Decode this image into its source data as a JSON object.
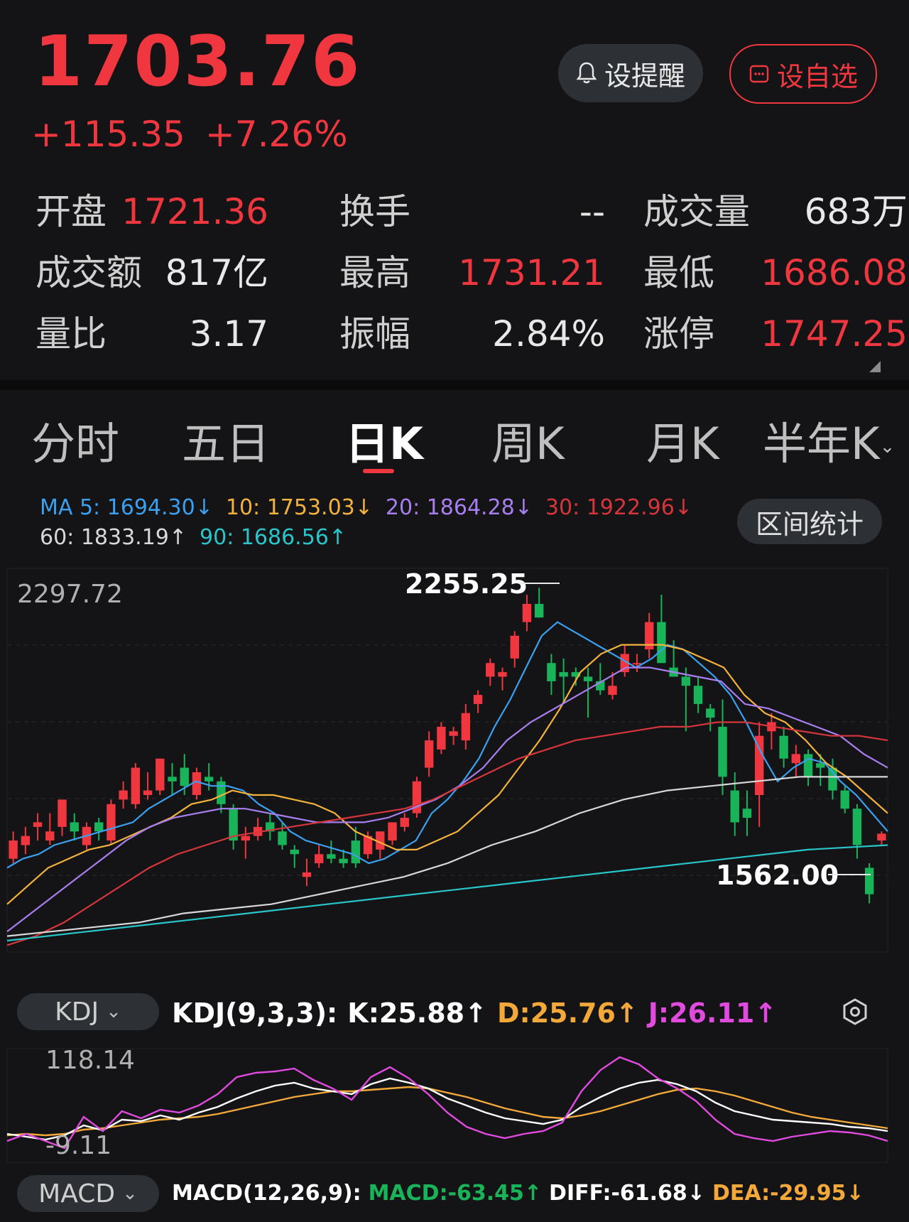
{
  "quote": {
    "price": "1703.76",
    "change": "+115.35",
    "change_pct": "+7.26%"
  },
  "actions": {
    "alert_label": "设提醒",
    "favorite_label": "设自选"
  },
  "stats": [
    [
      {
        "label": "开盘",
        "value": "1721.36",
        "color": "red"
      },
      {
        "label": "换手",
        "value": "--",
        "color": "white"
      },
      {
        "label": "成交量",
        "value": "683万",
        "color": "white"
      }
    ],
    [
      {
        "label": "成交额",
        "value": "817亿",
        "color": "white"
      },
      {
        "label": "最高",
        "value": "1731.21",
        "color": "red"
      },
      {
        "label": "最低",
        "value": "1686.08",
        "color": "red"
      }
    ],
    [
      {
        "label": "量比",
        "value": "3.17",
        "color": "white"
      },
      {
        "label": "振幅",
        "value": "2.84%",
        "color": "white"
      },
      {
        "label": "涨停",
        "value": "1747.25",
        "color": "red"
      }
    ]
  ],
  "tabs": [
    "分时",
    "五日",
    "日K",
    "周K",
    "月K",
    "半年K"
  ],
  "active_tab": "日K",
  "ma_legend": {
    "ma5": "MA 5: 1694.30↓",
    "ma10": "10: 1753.03↓",
    "ma20": "20: 1864.28↓",
    "ma30": "30: 1922.96↓",
    "ma60": "60: 1833.19↑",
    "ma90": "90: 1686.56↑"
  },
  "range_button": "区间统计",
  "chart_axis": {
    "top_label": "2297.72",
    "high_annot": "2255.25",
    "low_annot": "1562.00"
  },
  "kdj": {
    "selector": "KDJ",
    "params": "KDJ(9,3,3):",
    "k": "K:25.88↑",
    "d": "D:25.76↑",
    "j": "J:26.11↑",
    "y_top": "118.14",
    "y_bottom": "-9.11"
  },
  "macd": {
    "selector": "MACD",
    "params": "MACD(12,26,9):",
    "macd": "MACD:-63.45↑",
    "diff": "DIFF:-61.68↓",
    "dea": "DEA:-29.95↓"
  },
  "colors": {
    "up": "#f0373f",
    "down": "#19b45a",
    "ma5": "#3aa0ef",
    "ma10": "#f3b23c",
    "ma20": "#a77ff0",
    "ma30": "#d7353c",
    "ma60": "#d8d8d8",
    "ma90": "#28c6c9",
    "kdj_k": "#ffffff",
    "kdj_d": "#f3a93a",
    "kdj_j": "#e04adf",
    "macd_val": "#19b45a"
  },
  "chart_data": {
    "type": "candlestick",
    "price_range": [
      1455,
      2298
    ],
    "candles": [
      {
        "o": 1660,
        "h": 1720,
        "l": 1650,
        "c": 1700
      },
      {
        "o": 1690,
        "h": 1730,
        "l": 1670,
        "c": 1710
      },
      {
        "o": 1730,
        "h": 1760,
        "l": 1700,
        "c": 1740
      },
      {
        "o": 1700,
        "h": 1760,
        "l": 1690,
        "c": 1720
      },
      {
        "o": 1730,
        "h": 1780,
        "l": 1710,
        "c": 1790
      },
      {
        "o": 1740,
        "h": 1760,
        "l": 1700,
        "c": 1720
      },
      {
        "o": 1690,
        "h": 1740,
        "l": 1680,
        "c": 1730
      },
      {
        "o": 1740,
        "h": 1750,
        "l": 1700,
        "c": 1720
      },
      {
        "o": 1700,
        "h": 1790,
        "l": 1690,
        "c": 1780
      },
      {
        "o": 1790,
        "h": 1830,
        "l": 1770,
        "c": 1810
      },
      {
        "o": 1780,
        "h": 1870,
        "l": 1770,
        "c": 1860
      },
      {
        "o": 1800,
        "h": 1850,
        "l": 1790,
        "c": 1810
      },
      {
        "o": 1810,
        "h": 1880,
        "l": 1800,
        "c": 1880
      },
      {
        "o": 1840,
        "h": 1870,
        "l": 1800,
        "c": 1830
      },
      {
        "o": 1860,
        "h": 1890,
        "l": 1800,
        "c": 1820
      },
      {
        "o": 1800,
        "h": 1860,
        "l": 1790,
        "c": 1850
      },
      {
        "o": 1840,
        "h": 1870,
        "l": 1810,
        "c": 1830
      },
      {
        "o": 1830,
        "h": 1840,
        "l": 1760,
        "c": 1780
      },
      {
        "o": 1770,
        "h": 1780,
        "l": 1680,
        "c": 1700
      },
      {
        "o": 1700,
        "h": 1730,
        "l": 1660,
        "c": 1710
      },
      {
        "o": 1710,
        "h": 1750,
        "l": 1700,
        "c": 1730
      },
      {
        "o": 1740,
        "h": 1760,
        "l": 1700,
        "c": 1720
      },
      {
        "o": 1720,
        "h": 1740,
        "l": 1680,
        "c": 1690
      },
      {
        "o": 1680,
        "h": 1690,
        "l": 1640,
        "c": 1670
      },
      {
        "o": 1620,
        "h": 1660,
        "l": 1600,
        "c": 1630
      },
      {
        "o": 1650,
        "h": 1690,
        "l": 1640,
        "c": 1670
      },
      {
        "o": 1670,
        "h": 1700,
        "l": 1650,
        "c": 1660
      },
      {
        "o": 1660,
        "h": 1680,
        "l": 1640,
        "c": 1650
      },
      {
        "o": 1700,
        "h": 1730,
        "l": 1640,
        "c": 1650
      },
      {
        "o": 1670,
        "h": 1720,
        "l": 1660,
        "c": 1710
      },
      {
        "o": 1680,
        "h": 1720,
        "l": 1660,
        "c": 1720
      },
      {
        "o": 1700,
        "h": 1740,
        "l": 1690,
        "c": 1740
      },
      {
        "o": 1730,
        "h": 1760,
        "l": 1720,
        "c": 1750
      },
      {
        "o": 1760,
        "h": 1840,
        "l": 1750,
        "c": 1830
      },
      {
        "o": 1860,
        "h": 1940,
        "l": 1840,
        "c": 1920
      },
      {
        "o": 1900,
        "h": 1960,
        "l": 1890,
        "c": 1950
      },
      {
        "o": 1930,
        "h": 1950,
        "l": 1910,
        "c": 1940
      },
      {
        "o": 1920,
        "h": 2000,
        "l": 1900,
        "c": 1980
      },
      {
        "o": 2000,
        "h": 2030,
        "l": 1980,
        "c": 2020
      },
      {
        "o": 2060,
        "h": 2100,
        "l": 2040,
        "c": 2090
      },
      {
        "o": 2060,
        "h": 2080,
        "l": 2030,
        "c": 2070
      },
      {
        "o": 2100,
        "h": 2160,
        "l": 2080,
        "c": 2150
      },
      {
        "o": 2180,
        "h": 2240,
        "l": 2160,
        "c": 2220
      },
      {
        "o": 2220,
        "h": 2255.25,
        "l": 2190,
        "c": 2190
      },
      {
        "o": 2090,
        "h": 2110,
        "l": 2020,
        "c": 2050
      },
      {
        "o": 2070,
        "h": 2100,
        "l": 2000,
        "c": 2060
      },
      {
        "o": 2070,
        "h": 2080,
        "l": 2040,
        "c": 2060
      },
      {
        "o": 2060,
        "h": 2080,
        "l": 1970,
        "c": 2050
      },
      {
        "o": 2050,
        "h": 2090,
        "l": 2020,
        "c": 2030
      },
      {
        "o": 2020,
        "h": 2070,
        "l": 2010,
        "c": 2040
      },
      {
        "o": 2070,
        "h": 2130,
        "l": 2060,
        "c": 2110
      },
      {
        "o": 2090,
        "h": 2110,
        "l": 2070,
        "c": 2090
      },
      {
        "o": 2120,
        "h": 2200,
        "l": 2100,
        "c": 2180
      },
      {
        "o": 2180,
        "h": 2240,
        "l": 2090,
        "c": 2090
      },
      {
        "o": 2080,
        "h": 2140,
        "l": 2060,
        "c": 2060
      },
      {
        "o": 2060,
        "h": 2080,
        "l": 1940,
        "c": 2040
      },
      {
        "o": 2040,
        "h": 2060,
        "l": 1980,
        "c": 2000
      },
      {
        "o": 1990,
        "h": 2000,
        "l": 1940,
        "c": 1970
      },
      {
        "o": 1950,
        "h": 2010,
        "l": 1800,
        "c": 1840
      },
      {
        "o": 1810,
        "h": 1850,
        "l": 1710,
        "c": 1740
      },
      {
        "o": 1770,
        "h": 1810,
        "l": 1710,
        "c": 1750
      },
      {
        "o": 1800,
        "h": 1960,
        "l": 1730,
        "c": 1930
      },
      {
        "o": 1940,
        "h": 1980,
        "l": 1900,
        "c": 1960
      },
      {
        "o": 1930,
        "h": 1950,
        "l": 1860,
        "c": 1880
      },
      {
        "o": 1870,
        "h": 1910,
        "l": 1840,
        "c": 1890
      },
      {
        "o": 1890,
        "h": 1900,
        "l": 1820,
        "c": 1840
      },
      {
        "o": 1870,
        "h": 1890,
        "l": 1820,
        "c": 1860
      },
      {
        "o": 1860,
        "h": 1880,
        "l": 1790,
        "c": 1810
      },
      {
        "o": 1810,
        "h": 1820,
        "l": 1760,
        "c": 1770
      },
      {
        "o": 1770,
        "h": 1780,
        "l": 1660,
        "c": 1690
      },
      {
        "o": 1640,
        "h": 1650,
        "l": 1562,
        "c": 1582
      },
      {
        "o": 1700,
        "h": 1720,
        "l": 1690,
        "c": 1715
      }
    ],
    "ma_lines": {
      "MA5": [
        1640,
        1660,
        1670,
        1690,
        1700,
        1710,
        1720,
        1730,
        1740,
        1770,
        1790,
        1810,
        1830,
        1820,
        1820,
        1810,
        1780,
        1760,
        1720,
        1700,
        1690,
        1680,
        1670,
        1650,
        1660,
        1680,
        1700,
        1760,
        1790,
        1830,
        1880,
        1950,
        2010,
        2080,
        2150,
        2180,
        2160,
        2140,
        2120,
        2100,
        2080,
        2100,
        2130,
        2120,
        2090,
        2060,
        2020,
        1960,
        1890,
        1830,
        1860,
        1880,
        1870,
        1830,
        1800,
        1760,
        1720
      ],
      "MA10": [
        1560,
        1600,
        1640,
        1660,
        1680,
        1690,
        1710,
        1730,
        1750,
        1780,
        1790,
        1810,
        1800,
        1800,
        1790,
        1780,
        1760,
        1720,
        1700,
        1680,
        1680,
        1700,
        1720,
        1760,
        1800,
        1860,
        1920,
        1990,
        2070,
        2110,
        2130,
        2130,
        2130,
        2120,
        2100,
        2080,
        2020,
        1980,
        1960,
        1920,
        1870,
        1840,
        1800,
        1760
      ],
      "MA20": [
        1500,
        1540,
        1580,
        1620,
        1660,
        1700,
        1730,
        1750,
        1760,
        1770,
        1770,
        1760,
        1750,
        1740,
        1740,
        1740,
        1750,
        1770,
        1790,
        1820,
        1860,
        1920,
        1960,
        1990,
        2020,
        2050,
        2080,
        2080,
        2070,
        2060,
        2050,
        2000,
        1990,
        1970,
        1950,
        1930,
        1890,
        1860
      ],
      "MA30": [
        1470,
        1490,
        1520,
        1560,
        1600,
        1640,
        1670,
        1690,
        1710,
        1720,
        1730,
        1740,
        1750,
        1760,
        1770,
        1790,
        1820,
        1850,
        1880,
        1900,
        1920,
        1930,
        1940,
        1950,
        1950,
        1960,
        1960,
        1950,
        1940,
        1930,
        1930,
        1920
      ],
      "MA60": [
        1490,
        1500,
        1510,
        1520,
        1540,
        1550,
        1560,
        1580,
        1600,
        1620,
        1650,
        1690,
        1720,
        1760,
        1790,
        1810,
        1820,
        1830,
        1840,
        1840,
        1840
      ],
      "MA90": [
        1480,
        1500,
        1520,
        1540,
        1560,
        1580,
        1600,
        1620,
        1640,
        1660,
        1680,
        1690
      ]
    }
  }
}
